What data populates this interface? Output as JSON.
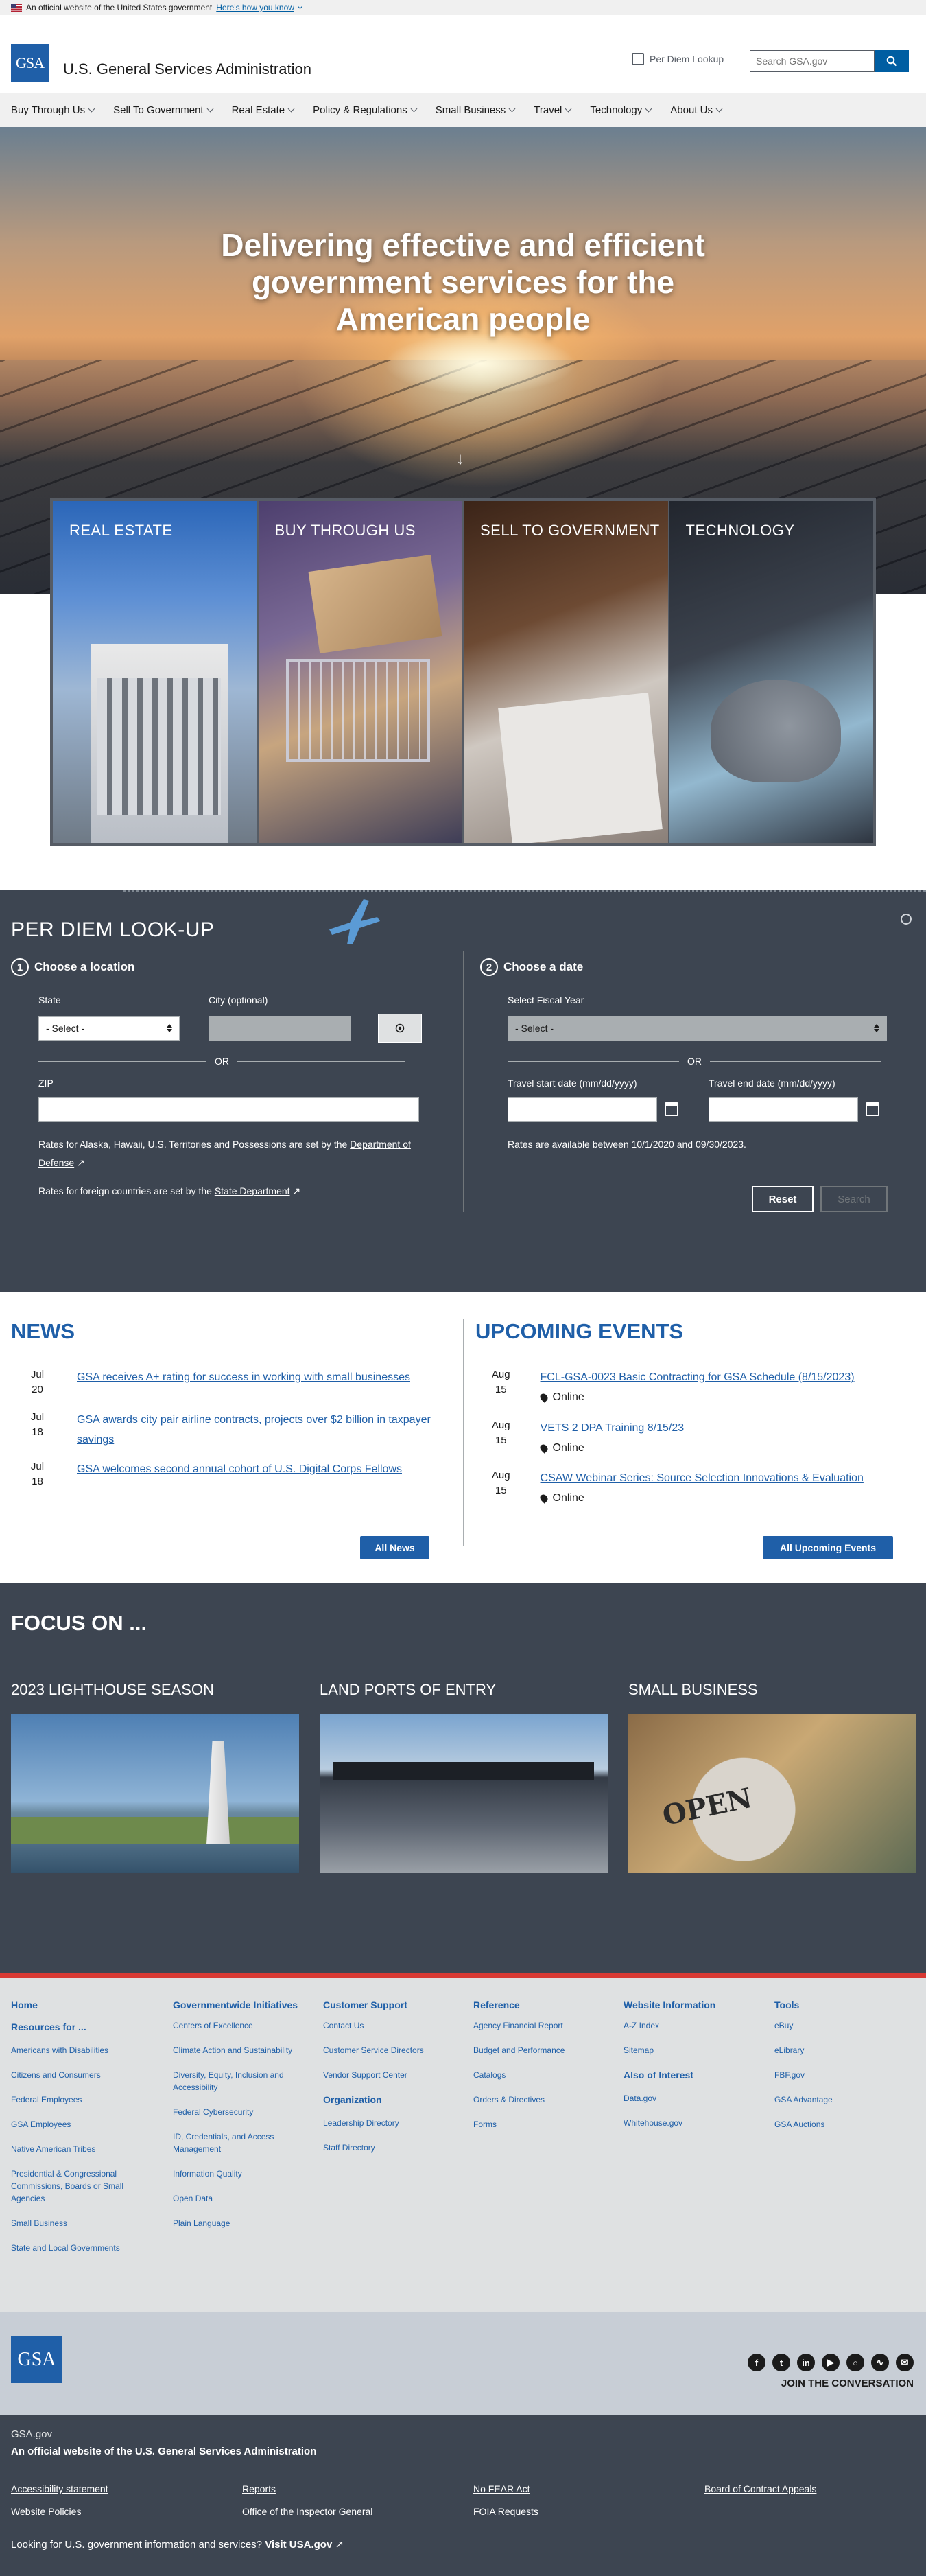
{
  "banner": {
    "text": "An official website of the United States government",
    "link": "Here's how you know"
  },
  "header": {
    "logo": "GSA",
    "title": "U.S. General Services Administration",
    "per_diem_link": "Per Diem Lookup",
    "search_placeholder": "Search GSA.gov"
  },
  "nav": {
    "items": [
      "Buy Through Us",
      "Sell To Government",
      "Real Estate",
      "Policy & Regulations",
      "Small Business",
      "Travel",
      "Technology",
      "About Us"
    ]
  },
  "hero": {
    "headline": "Delivering effective and efficient government services for the American people"
  },
  "tiles": [
    "REAL ESTATE",
    "BUY THROUGH US",
    "SELL TO GOVERNMENT",
    "TECHNOLOGY"
  ],
  "per_diem": {
    "title": "PER DIEM LOOK-UP",
    "step1": {
      "num": "1",
      "label": "Choose a location"
    },
    "step2": {
      "num": "2",
      "label": "Choose a date"
    },
    "state_label": "State",
    "state_value": "- Select -",
    "city_label": "City (optional)",
    "or": "OR",
    "zip_label": "ZIP",
    "note1": "Rates for Alaska, Hawaii, U.S. Territories and Possessions are set by the",
    "note1_link": "Department of Defense",
    "note2": "Rates for foreign countries are set by the",
    "note2_link": "State Department",
    "fiscal_label": "Select Fiscal Year",
    "fiscal_value": "- Select -",
    "start_label": "Travel start date (mm/dd/yyyy)",
    "end_label": "Travel end date (mm/dd/yyyy)",
    "rates_note": "Rates are available between 10/1/2020 and 09/30/2023.",
    "reset": "Reset",
    "search": "Search"
  },
  "news": {
    "title": "NEWS",
    "items": [
      {
        "month": "Jul",
        "day": "20",
        "title": "GSA receives A+ rating for success in working with small businesses"
      },
      {
        "month": "Jul",
        "day": "18",
        "title": "GSA awards city pair airline contracts, projects over $2 billion in taxpayer savings"
      },
      {
        "month": "Jul",
        "day": "18",
        "title": "GSA welcomes second annual cohort of U.S. Digital Corps Fellows"
      }
    ],
    "button": "All News"
  },
  "events": {
    "title": "UPCOMING EVENTS",
    "items": [
      {
        "month": "Aug",
        "day": "15",
        "title": "FCL-GSA-0023 Basic Contracting for GSA Schedule (8/15/2023)",
        "location": "Online"
      },
      {
        "month": "Aug",
        "day": "15",
        "title": "VETS 2 DPA Training 8/15/23",
        "location": "Online"
      },
      {
        "month": "Aug",
        "day": "15",
        "title": "CSAW Webinar Series: Source Selection Innovations & Evaluation",
        "location": "Online"
      }
    ],
    "button": "All Upcoming Events"
  },
  "focus": {
    "title": "FOCUS ON ...",
    "cards": [
      {
        "title": "2023 LIGHTHOUSE SEASON"
      },
      {
        "title": "LAND PORTS OF ENTRY"
      },
      {
        "title": "SMALL BUSINESS",
        "sign": "OPEN"
      }
    ]
  },
  "footer": {
    "col1": {
      "home": "Home",
      "resources_head": "Resources for ...",
      "links": [
        "Americans with Disabilities",
        "Citizens and Consumers",
        "Federal Employees",
        "GSA Employees",
        "Native American Tribes",
        "Presidential & Congressional Commissions, Boards or Small Agencies",
        "Small Business",
        "State and Local Governments"
      ]
    },
    "col2": {
      "head": "Governmentwide Initiatives",
      "links": [
        "Centers of Excellence",
        "Climate Action and Sustainability",
        "Diversity, Equity, Inclusion and Accessibility",
        "Federal Cybersecurity",
        "ID, Credentials, and Access Management",
        "Information Quality",
        "Open Data",
        "Plain Language"
      ]
    },
    "col3": {
      "head": "Customer Support",
      "links": [
        "Contact Us",
        "Customer Service Directors",
        "Vendor Support Center"
      ],
      "sub": "Organization",
      "sub_links": [
        "Leadership Directory",
        "Staff Directory"
      ]
    },
    "col4": {
      "head": "Reference",
      "links": [
        "Agency Financial Report",
        "Budget and Performance",
        "Catalogs",
        "Orders & Directives",
        "Forms"
      ]
    },
    "col5": {
      "head": "Website Information",
      "links": [
        "A-Z Index",
        "Sitemap"
      ],
      "sub": "Also of Interest",
      "sub_links": [
        "Data.gov",
        "Whitehouse.gov"
      ]
    },
    "col6": {
      "head": "Tools",
      "links": [
        "eBuy",
        "eLibrary",
        "FBF.gov",
        "GSA Advantage",
        "GSA Auctions"
      ]
    }
  },
  "brand": {
    "logo": "GSA",
    "join": "JOIN THE CONVERSATION",
    "social_icons": [
      "facebook-icon",
      "twitter-icon",
      "linkedin-icon",
      "youtube-icon",
      "instagram-icon",
      "rss-icon",
      "email-icon"
    ]
  },
  "identifier": {
    "domain": "GSA.gov",
    "official": "An official website of the U.S. General Services Administration",
    "links": [
      "Accessibility statement",
      "Reports",
      "No FEAR Act",
      "Board of Contract Appeals",
      "Website Policies",
      "Office of the Inspector General",
      "FOIA Requests"
    ],
    "bottom_text": "Looking for U.S. government information and services?",
    "bottom_link": "Visit USA.gov"
  },
  "colors": {
    "brand_blue": "#1f5fa8",
    "dark_panel": "#3d4551",
    "footer_red": "#d83933"
  }
}
